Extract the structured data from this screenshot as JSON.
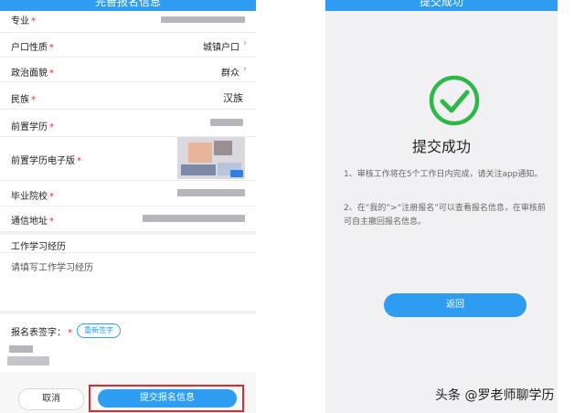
{
  "left_screen": {
    "title": "完善报名信息",
    "fields": [
      {
        "label": "专业",
        "required": "*",
        "value": ""
      },
      {
        "label": "户口性质",
        "required": "*",
        "value": "城镇户口"
      },
      {
        "label": "政治面貌",
        "required": "*",
        "value": "群众"
      },
      {
        "label": "民族",
        "required": "*",
        "value": "汉族"
      },
      {
        "label": "前置学历",
        "required": "*",
        "value": ""
      },
      {
        "label": "前置学历电子版",
        "required": "*",
        "value": ""
      },
      {
        "label": "毕业院校",
        "required": "*",
        "value": ""
      },
      {
        "label": "通信地址",
        "required": "*",
        "value": ""
      }
    ],
    "chevron": "›",
    "work_section_title": "工作学习经历",
    "work_placeholder": "请填写工作学习经历",
    "signature_label": "报名表签字：",
    "signature_required": "*",
    "resign_button": "重新签字",
    "cancel_button": "取消",
    "submit_button": "提交报名信息",
    "colors": {
      "accent": "#2e9cf0",
      "highlight": "#e12a2a"
    }
  },
  "right_screen": {
    "title": "提交成功",
    "success_icon": "check-circle-icon",
    "success_text": "提交成功",
    "notes": [
      "1、审核工作将在5个工作日内完成，请关注app通知。",
      "2、在“我的”>“注册报名”可以查看报名信息，在审核前可自主撤回报名信息。"
    ],
    "back_button": "返回",
    "colors": {
      "success": "#2fb84a"
    }
  },
  "watermark": "头条 @罗老师聊学历"
}
